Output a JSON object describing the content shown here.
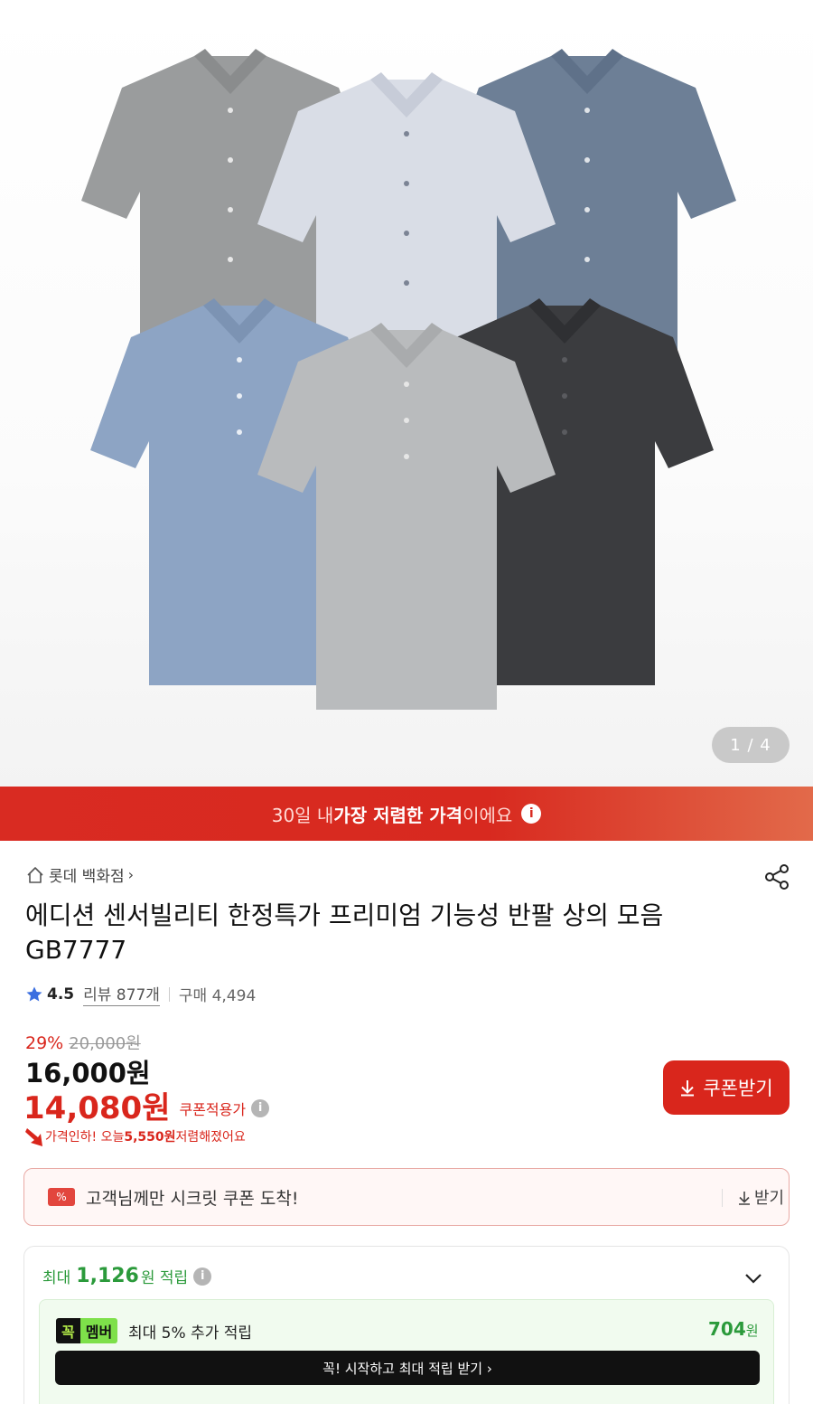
{
  "gallery": {
    "pager_text": "1 / 4",
    "shirt_colors": [
      "#9a9c9d",
      "#d9dde6",
      "#6d7f96",
      "#8da4c4",
      "#b9bbbd",
      "#3b3c3f"
    ]
  },
  "banner": {
    "part1": "30일 내 ",
    "part2": "가장 저렴한 가격",
    "part3": "이에요",
    "info_icon": "info-icon"
  },
  "seller": {
    "name": "롯데 백화점",
    "chevron": "›"
  },
  "product": {
    "title": "에디션 센서빌리티 한정특가 프리미엄 기능성 반팔 상의 모음 GB7777",
    "rating": "4.5",
    "review_text": "리뷰 877개",
    "purchase_text": "구매 4,494"
  },
  "price": {
    "discount_pct": "29%",
    "original": "20,000원",
    "sale": "16,000원",
    "coupon_price": "14,080원",
    "coupon_note": "쿠폰적용가",
    "drop_text_1": "가격인하! 오늘 ",
    "drop_amount": "5,550원",
    "drop_text_2": " 저렴해졌어요"
  },
  "coupon_button": {
    "label": "쿠폰받기",
    "icon": "download-icon"
  },
  "secret_coupon": {
    "ticket": "%",
    "label": "고객님께만 시크릿 쿠폰 도착!",
    "get_label": "받기"
  },
  "points": {
    "prefix": "최대",
    "amount": "1,126",
    "suffix": "원 적립",
    "member_badge_1": "꼭",
    "member_badge_2": "멤버",
    "member_desc": "최대 5% 추가 적립",
    "member_amount": "704",
    "member_unit": "원",
    "cta": "꼭! 시작하고 최대 적립 받기 ›"
  },
  "colors": {
    "brand_red": "#d9261c",
    "points_green": "#2b9a3b"
  }
}
